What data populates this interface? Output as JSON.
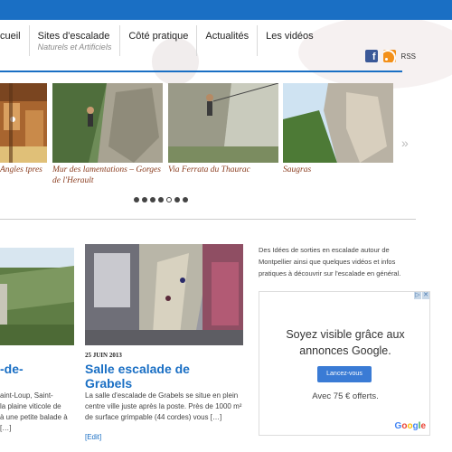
{
  "nav": {
    "items": [
      {
        "label": "cueil",
        "sub": ""
      },
      {
        "label": "Sites d'escalade",
        "sub": "Naturels et Artificiels"
      },
      {
        "label": "Côté pratique",
        "sub": ""
      },
      {
        "label": "Actualités",
        "sub": ""
      },
      {
        "label": "Les vidéos",
        "sub": ""
      }
    ]
  },
  "social": {
    "facebook_icon": "facebook-icon",
    "rss_icon": "rss-icon",
    "rss_label": "RSS"
  },
  "slider": {
    "slides": [
      {
        "caption": "Angles tpres"
      },
      {
        "caption": "Mur des lamentations – Gorges de l'Herault"
      },
      {
        "caption": "Via Ferrata du Thaurac"
      },
      {
        "caption": "Saugras"
      }
    ],
    "next_arrow": "»",
    "dot_count": 7,
    "active_dot": 4
  },
  "posts": [
    {
      "title": "-de-",
      "excerpt_lines": [
        "aint-Loup, Saint-",
        "la plaine viticole de",
        "à une petite balade à",
        "[…]"
      ]
    },
    {
      "date": "25 JUIN 2013",
      "title_lines": [
        "Salle escalade de",
        "Grabels"
      ],
      "excerpt_lines": [
        "La salle d'escalade de Grabels se situe en plein",
        "centre ville juste après la poste. Près de 1000 m²",
        "de surface grimpable (44 cordes) vous […]"
      ],
      "edit_label": "[Edit]"
    }
  ],
  "sidebar": {
    "intro_lines": [
      "Des Idées de sorties en escalade autour de",
      "Montpellier ainsi que quelques vidéos et infos",
      "pratiques à découvrir sur l'escalade en général."
    ]
  },
  "ad": {
    "headline_lines": [
      "Soyez visible grâce aux",
      "annonces Google."
    ],
    "button_label": "Lancez-vous",
    "offer": "Avec 75 € offerts.",
    "logo_text": "Google"
  },
  "colors": {
    "brand_blue": "#1a6fc4",
    "caption_brown": "#8a3c1e"
  }
}
